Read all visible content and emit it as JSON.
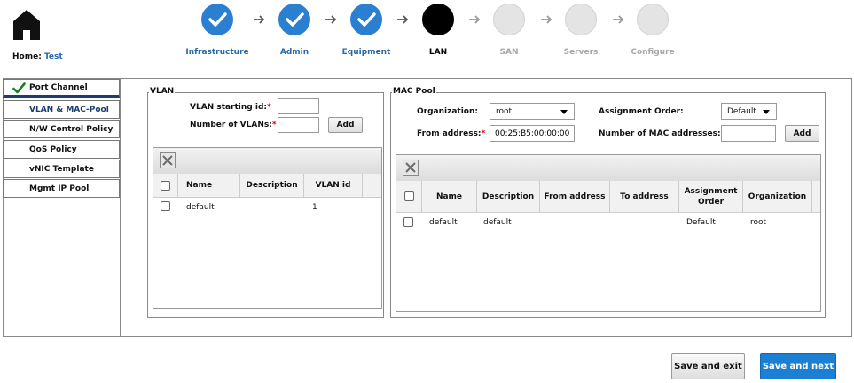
{
  "home": {
    "label": "Home:",
    "value": "Test"
  },
  "wizard": {
    "steps": [
      {
        "label": "Infrastructure",
        "status": "done"
      },
      {
        "label": "Admin",
        "status": "done"
      },
      {
        "label": "Equipment",
        "status": "done"
      },
      {
        "label": "LAN",
        "status": "current"
      },
      {
        "label": "SAN",
        "status": "todo"
      },
      {
        "label": "Servers",
        "status": "todo"
      },
      {
        "label": "Configure",
        "status": "todo"
      }
    ]
  },
  "sidebar": {
    "items": [
      {
        "label": "Port Channel",
        "checked": true
      },
      {
        "label": "VLAN & MAC-Pool",
        "selected": true
      },
      {
        "label": "N/W Control Policy"
      },
      {
        "label": "QoS Policy"
      },
      {
        "label": "vNIC Template"
      },
      {
        "label": "Mgmt IP Pool"
      }
    ]
  },
  "vlan": {
    "legend": "VLAN",
    "start_label": "VLAN starting id:",
    "start_value": "",
    "count_label": "Number of VLANs:",
    "count_value": "",
    "add_label": "Add",
    "table": {
      "headers": [
        "Name",
        "Description",
        "VLAN id"
      ],
      "rows": [
        {
          "name": "default",
          "description": "",
          "vlan_id": "1"
        }
      ]
    }
  },
  "mac": {
    "legend": "MAC Pool",
    "org_label": "Organization:",
    "org_value": "root",
    "order_label": "Assignment Order:",
    "order_value": "Default",
    "from_label": "From address:",
    "from_value": "00:25:B5:00:00:00",
    "count_label": "Number of MAC addresses:",
    "count_value": "",
    "add_label": "Add",
    "table": {
      "headers": [
        "Name",
        "Description",
        "From address",
        "To address",
        "Assignment Order",
        "Organization"
      ],
      "rows": [
        {
          "name": "default",
          "description": "default",
          "from": "",
          "to": "",
          "order": "Default",
          "org": "root"
        }
      ]
    }
  },
  "footer": {
    "save_exit": "Save and exit",
    "save_next": "Save and next"
  },
  "colors": {
    "accent": "#2b7fd1",
    "done_label": "#2a6aa8",
    "required": "#dd0000",
    "primary_button": "#1b7fd3",
    "nav_selected": "#1e3c6e",
    "check": "#1e7d1e"
  }
}
